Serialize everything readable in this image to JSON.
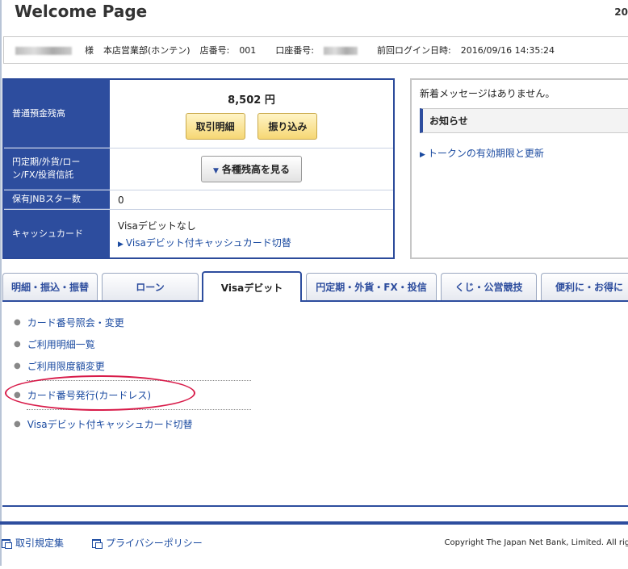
{
  "header": {
    "title": "Welcome Page",
    "year_fragment": "20"
  },
  "user": {
    "honorific": "様",
    "branch": "本店営業部(ホンテン)",
    "branch_no_label": "店番号:",
    "branch_no": "001",
    "account_no_label": "口座番号:",
    "last_login_label": "前回ログイン日時:",
    "last_login": "2016/09/16 14:35:24"
  },
  "account": {
    "balance_label": "普通預金残高",
    "balance": "8,502 円",
    "details_button": "取引明細",
    "transfer_button": "振り込み",
    "other_label": "円定期/外貨/ローン/FX/投資信託",
    "other_button": "各種残高を見る",
    "jnb_star_label": "保有JNBスター数",
    "jnb_star_value": "0",
    "cashcard_label": "キャッシュカード",
    "cashcard_status": "Visaデビットなし",
    "cashcard_link": "Visaデビット付キャッシュカード切替"
  },
  "messages": {
    "empty_text": "新着メッセージはありません。",
    "notice_heading": "お知らせ",
    "notice_link": "トークンの有効期限と更新"
  },
  "tabs": [
    {
      "label": "明細・振込・振替"
    },
    {
      "label": "ローン"
    },
    {
      "label": "Visaデビット"
    },
    {
      "label": "円定期・外貨・FX・投信"
    },
    {
      "label": "くじ・公営競技"
    },
    {
      "label": "便利に・お得に"
    }
  ],
  "menu": [
    {
      "label": "カード番号照会・変更"
    },
    {
      "label": "ご利用明細一覧"
    },
    {
      "label": "ご利用限度額変更"
    },
    {
      "label": "カード番号発行(カードレス)"
    },
    {
      "label": "Visaデビット付キャッシュカード切替"
    }
  ],
  "footer": {
    "terms": "取引規定集",
    "privacy": "プライバシーポリシー",
    "copyright": "Copyright The Japan Net Bank, Limited. All rights res"
  },
  "colors": {
    "accent": "#2d4d9e",
    "highlight": "#d81c4a",
    "button_yellow": "#f6d774"
  }
}
